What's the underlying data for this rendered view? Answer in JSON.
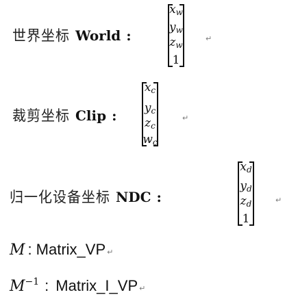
{
  "rows": [
    {
      "id": "world",
      "cjk": "世界坐标",
      "label": "World",
      "colon": ":",
      "components": [
        {
          "var": "x",
          "sub": "w"
        },
        {
          "var": "y",
          "sub": "w"
        },
        {
          "var": "z",
          "sub": "w"
        },
        {
          "var": "1",
          "sub": ""
        }
      ],
      "return_mark": "↵"
    },
    {
      "id": "clip",
      "cjk": "裁剪坐标",
      "label": "Clip",
      "colon": ":",
      "components": [
        {
          "var": "x",
          "sub": "c"
        },
        {
          "var": "y",
          "sub": "c"
        },
        {
          "var": "z",
          "sub": "c"
        },
        {
          "var": "w",
          "sub": "c"
        }
      ],
      "return_mark": "↵"
    },
    {
      "id": "ndc",
      "cjk": "归一化设备坐标",
      "label": "NDC",
      "colon": ":",
      "components": [
        {
          "var": "x",
          "sub": "d"
        },
        {
          "var": "y",
          "sub": "d"
        },
        {
          "var": "z",
          "sub": "d"
        },
        {
          "var": "1",
          "sub": ""
        }
      ],
      "return_mark": "↵"
    }
  ],
  "matrices": [
    {
      "symbol": "M",
      "sup": "",
      "colon": ":",
      "name": "Matrix_VP",
      "return_mark": "↵"
    },
    {
      "symbol": "M",
      "sup": "−1",
      "colon": ":",
      "name": "Matrix_I_VP",
      "return_mark": "↵"
    }
  ]
}
